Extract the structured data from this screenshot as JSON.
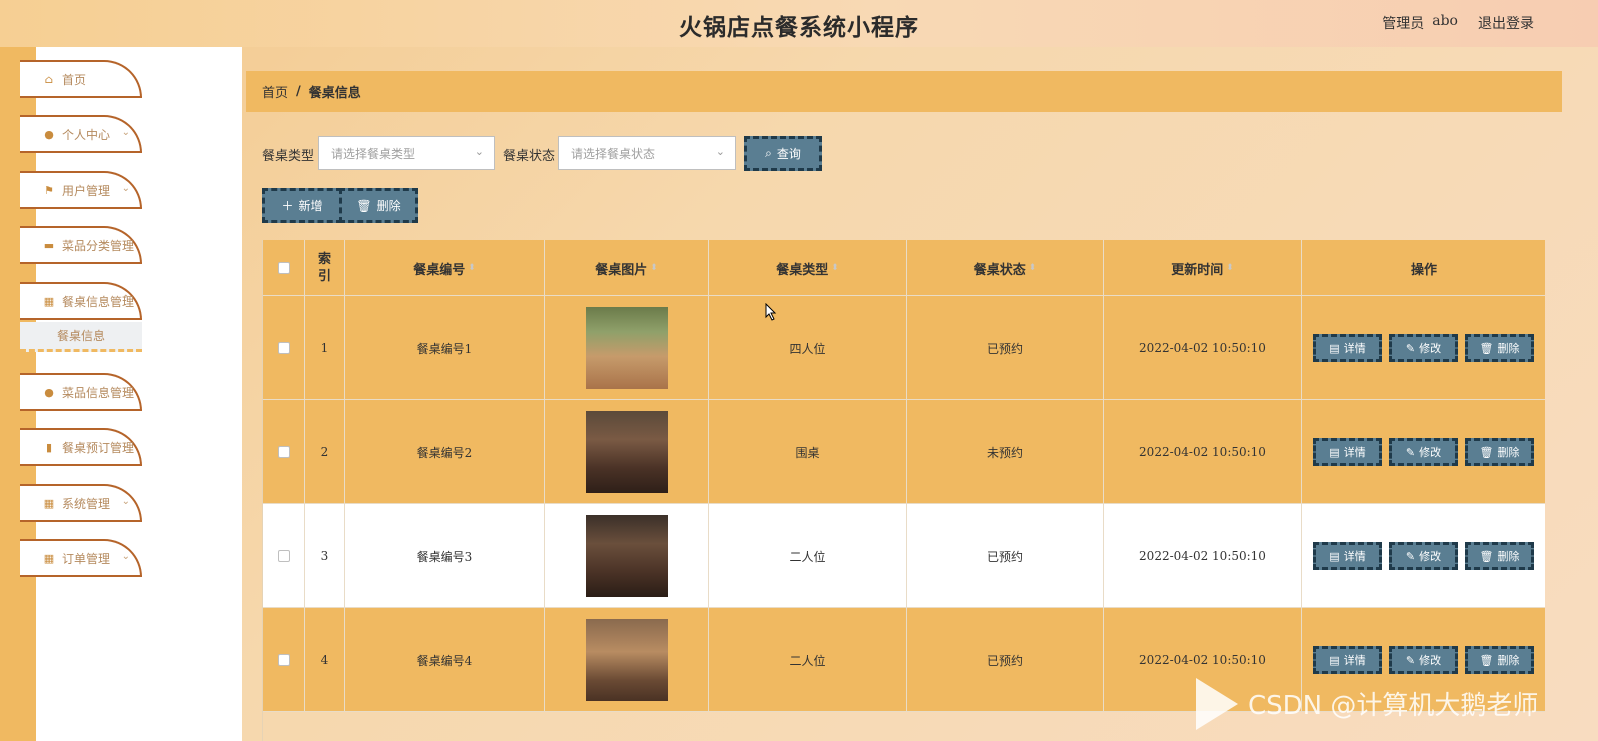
{
  "header": {
    "title": "火锅店点餐系统小程序",
    "role": "管理员",
    "username": "abo",
    "logout": "退出登录"
  },
  "sidebar": {
    "items": [
      {
        "label": "首页",
        "icon": "home-icon",
        "glyph": "⌂",
        "chevron": false
      },
      {
        "label": "个人中心",
        "icon": "user-icon",
        "glyph": "●",
        "chevron": true
      },
      {
        "label": "用户管理",
        "icon": "flag-icon",
        "glyph": "⚑",
        "chevron": true
      },
      {
        "label": "菜品分类管理",
        "icon": "chat-icon",
        "glyph": "▬",
        "chevron": true
      },
      {
        "label": "餐桌信息管理",
        "icon": "grid-icon",
        "glyph": "▦",
        "chevron": true
      },
      {
        "label": "菜品信息管理",
        "icon": "location-icon",
        "glyph": "●",
        "chevron": true
      },
      {
        "label": "餐桌预订管理",
        "icon": "bar-chart-icon",
        "glyph": "▮",
        "chevron": true
      },
      {
        "label": "系统管理",
        "icon": "apps-icon",
        "glyph": "▦",
        "chevron": true
      },
      {
        "label": "订单管理",
        "icon": "apps-icon",
        "glyph": "▦",
        "chevron": true
      }
    ],
    "submenu": "餐桌信息"
  },
  "breadcrumb": {
    "home": "首页",
    "sep": "/",
    "current": "餐桌信息"
  },
  "filters": {
    "type_label": "餐桌类型",
    "type_placeholder": "请选择餐桌类型",
    "status_label": "餐桌状态",
    "status_placeholder": "请选择餐桌状态",
    "query": "查询"
  },
  "toolbar": {
    "add": "新增",
    "delete": "删除"
  },
  "table": {
    "headers": [
      "索引",
      "餐桌编号",
      "餐桌图片",
      "餐桌类型",
      "餐桌状态",
      "更新时间",
      "操作"
    ],
    "rows": [
      {
        "index": "1",
        "code": "餐桌编号1",
        "type": "四人位",
        "status": "已预约",
        "time": "2022-04-02 10:50:10"
      },
      {
        "index": "2",
        "code": "餐桌编号2",
        "type": "围桌",
        "status": "未预约",
        "time": "2022-04-02 10:50:10"
      },
      {
        "index": "3",
        "code": "餐桌编号3",
        "type": "二人位",
        "status": "已预约",
        "time": "2022-04-02 10:50:10"
      },
      {
        "index": "4",
        "code": "餐桌编号4",
        "type": "二人位",
        "status": "已预约",
        "time": "2022-04-02 10:50:10"
      }
    ],
    "actions": {
      "detail": "详情",
      "edit": "修改",
      "delete": "删除"
    }
  },
  "watermark": "CSDN @计算机大鹅老师"
}
